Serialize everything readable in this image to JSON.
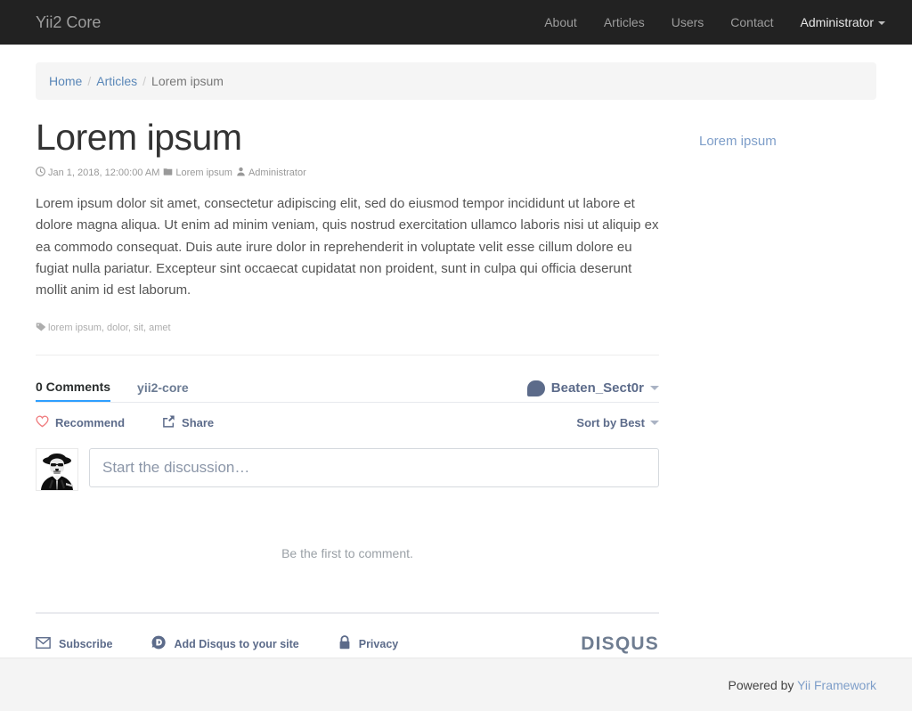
{
  "navbar": {
    "brand": "Yii2 Core",
    "items": [
      {
        "label": "About",
        "name": "about"
      },
      {
        "label": "Articles",
        "name": "articles"
      },
      {
        "label": "Users",
        "name": "users"
      },
      {
        "label": "Contact",
        "name": "contact"
      },
      {
        "label": "Administrator",
        "name": "administrator",
        "dropdown": true
      }
    ],
    "bg_color": "#222222",
    "link_color": "#9d9d9d"
  },
  "breadcrumb": {
    "home": "Home",
    "sep1": "/",
    "articles": "Articles",
    "sep2": "/",
    "current": "Lorem ipsum"
  },
  "article": {
    "title": "Lorem ipsum",
    "meta": {
      "date_icon": "clock-icon",
      "date": "Jan 1, 2018, 12:00:00 AM",
      "category_icon": "folder-icon",
      "category": "Lorem ipsum",
      "author_icon": "user-icon",
      "author": "Administrator"
    },
    "body": "Lorem ipsum dolor sit amet, consectetur adipiscing elit, sed do eiusmod tempor incididunt ut labore et dolore magna aliqua. Ut enim ad minim veniam, quis nostrud exercitation ullamco laboris nisi ut aliquip ex ea commodo consequat. Duis aute irure dolor in reprehenderit in voluptate velit esse cillum dolore eu fugiat nulla pariatur. Excepteur sint occaecat cupidatat non proident, sunt in culpa qui officia deserunt mollit anim id est laborum.",
    "tags_icon": "tag-icon",
    "tags": "lorem ipsum, dolor, sit, amet"
  },
  "sidebar": {
    "link": "Lorem ipsum"
  },
  "disqus": {
    "tabs": [
      {
        "label": "0 Comments",
        "name": "comments",
        "active": true
      },
      {
        "label": "yii2-core",
        "name": "forum",
        "active": false
      }
    ],
    "user": {
      "name": "Beaten_Sect0r",
      "avatar_icon": "speech-bubble-icon",
      "caret_icon": "chevron-down-icon"
    },
    "actions": [
      {
        "label": "Recommend",
        "name": "recommend",
        "icon": "heart-icon"
      },
      {
        "label": "Share",
        "name": "share",
        "icon": "share-icon"
      }
    ],
    "sort": {
      "label": "Sort by Best",
      "icon": "chevron-down-icon"
    },
    "compose": {
      "avatar_icon": "user-avatar-image",
      "placeholder": "Start the discussion…"
    },
    "empty_message": "Be the first to comment.",
    "footer_links": [
      {
        "label": "Subscribe",
        "name": "subscribe",
        "icon": "envelope-icon"
      },
      {
        "label": "Add Disqus to your site",
        "name": "add-disqus",
        "icon": "disqus-d-icon"
      },
      {
        "label": "Privacy",
        "name": "privacy",
        "icon": "lock-icon"
      }
    ],
    "logo": "DISQUS",
    "accent_color": "#2e9fff",
    "text_color": "#5c6b8a"
  },
  "footer": {
    "powered_by": "Powered by",
    "framework": "Yii Framework"
  }
}
